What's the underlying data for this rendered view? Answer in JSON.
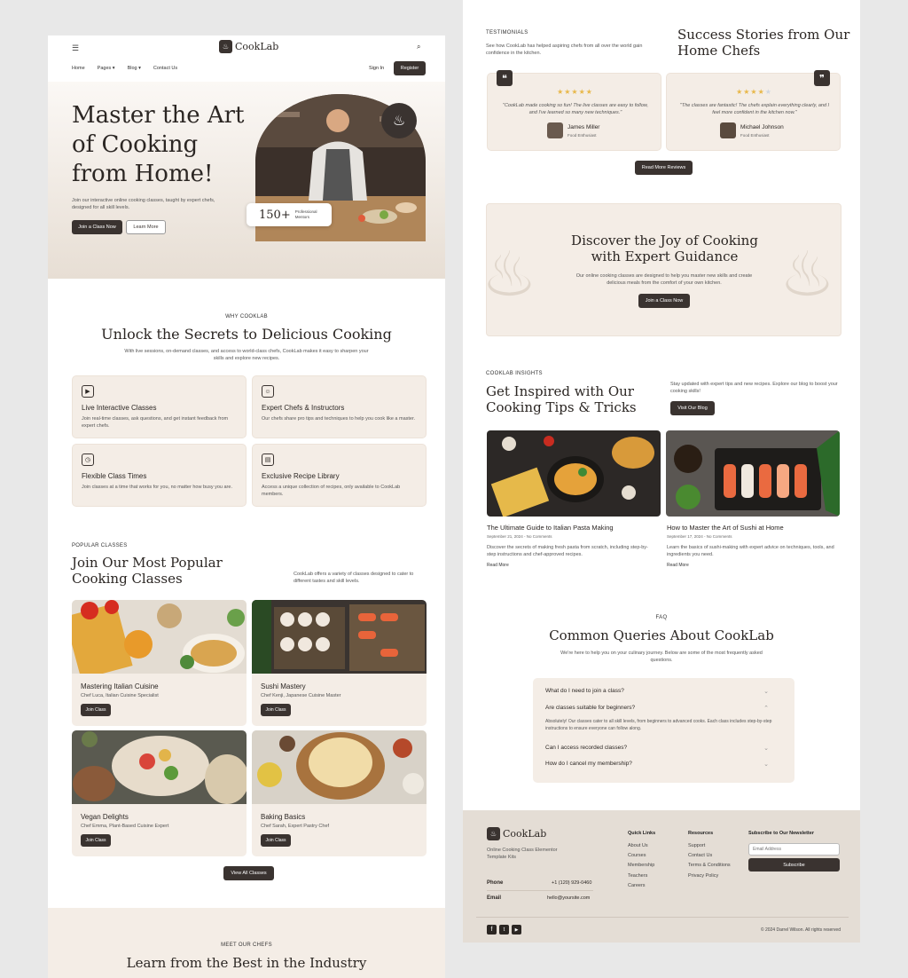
{
  "brand": {
    "name": "CookLab"
  },
  "nav": {
    "items": [
      {
        "label": "Home"
      },
      {
        "label": "Pages"
      },
      {
        "label": "Blog"
      },
      {
        "label": "Contact Us"
      }
    ],
    "signin": "Sign In",
    "register": "Register"
  },
  "hero": {
    "title_lines": [
      "Master the Art",
      "of Cooking",
      "from Home!"
    ],
    "desc": "Join our interactive online cooking classes, taught by expert chefs, designed for all skill levels.",
    "primary_btn": "Join a Class Now",
    "secondary_btn": "Learn More",
    "stat_number": "150+",
    "stat_label": "Professional Mentors"
  },
  "why": {
    "eyebrow": "WHY COOKLAB",
    "title": "Unlock the Secrets to Delicious Cooking",
    "desc": "With live sessions, on-demand classes, and access to world-class chefs, CookLab makes it easy to sharpen your skills and explore new recipes.",
    "features": [
      {
        "title": "Live Interactive Classes",
        "desc": "Join real-time classes, ask questions, and get instant feedback from expert chefs.",
        "icon": "video-icon"
      },
      {
        "title": "Expert Chefs & Instructors",
        "desc": "Our chefs share pro tips and techniques to help you cook like a master.",
        "icon": "chef-icon"
      },
      {
        "title": "Flexible Class Times",
        "desc": "Join classes at a time that works for you, no matter how busy you are.",
        "icon": "clock-icon"
      },
      {
        "title": "Exclusive Recipe Library",
        "desc": "Access a unique collection of recipes, only available to CookLab members.",
        "icon": "book-icon"
      }
    ]
  },
  "popular": {
    "eyebrow": "POPULAR CLASSES",
    "title_lines": [
      "Join Our Most Popular",
      "Cooking Classes"
    ],
    "desc": "CookLab offers a variety of classes designed to cater to different tastes and skill levels.",
    "classes": [
      {
        "title": "Mastering Italian Cuisine",
        "chef": "Chef Luca, Italian Cuisine Specialist",
        "button": "Join Class"
      },
      {
        "title": "Sushi Mastery",
        "chef": "Chef Kenji, Japanese Cuisine Master",
        "button": "Join Class"
      },
      {
        "title": "Vegan Delights",
        "chef": "Chef Emma, Plant-Based Cuisine Expert",
        "button": "Join Class"
      },
      {
        "title": "Baking Basics",
        "chef": "Chef Sarah, Expert Pastry Chef",
        "button": "Join Class"
      }
    ],
    "view_all": "View All Classes"
  },
  "chefs": {
    "eyebrow": "MEET OUR CHEFS",
    "title": "Learn from the Best in the Industry"
  },
  "testimonials": {
    "eyebrow": "TESTIMONIALS",
    "desc": "See how CookLab has helped aspiring chefs from all over the world gain confidence in the kitchen.",
    "title_lines": [
      "Success Stories from Our",
      "Home Chefs"
    ],
    "items": [
      {
        "quote": "\"CookLab made cooking so fun! The live classes are easy to follow, and I've learned so many new techniques.\"",
        "name": "James Miller",
        "role": "Food Enthusiast",
        "rating": 5
      },
      {
        "quote": "\"The classes are fantastic! The chefs explain everything clearly, and I feel more confident in the kitchen now.\"",
        "name": "Michael Johnson",
        "role": "Food Enthusiast",
        "rating": 4
      }
    ],
    "more_btn": "Read More Reviews"
  },
  "cta": {
    "title_lines": [
      "Discover the Joy of Cooking",
      "with Expert Guidance"
    ],
    "desc": "Our online cooking classes are designed to help you master new skills and create delicious meals from the comfort of your own kitchen.",
    "button": "Join a Class Now"
  },
  "insights": {
    "eyebrow": "COOKLAB INSIGHTS",
    "title_lines": [
      "Get Inspired with Our",
      "Cooking Tips & Tricks"
    ],
    "desc": "Stay updated with expert tips and new recipes. Explore our blog to boost your cooking skills!",
    "button": "Visit Our Blog",
    "posts": [
      {
        "title": "The Ultimate Guide to Italian Pasta Making",
        "meta": "September 21, 2024 - No Comments",
        "excerpt": "Discover the secrets of making fresh pasta from scratch, including step-by-step instructions and chef-approved recipes.",
        "link": "Read More"
      },
      {
        "title": "How to Master the Art of Sushi at Home",
        "meta": "September 17, 2024 - No Comments",
        "excerpt": "Learn the basics of sushi-making with expert advice on techniques, tools, and ingredients you need.",
        "link": "Read More"
      }
    ]
  },
  "faq": {
    "eyebrow": "FAQ",
    "title": "Common Queries About CookLab",
    "desc": "We're here to help you on your culinary journey. Below are some of the most frequently asked questions.",
    "items": [
      {
        "q": "What do I need to join a class?"
      },
      {
        "q": "Are classes suitable for beginners?",
        "a": "Absolutely! Our classes cater to all skill levels, from beginners to advanced cooks. Each class includes step-by-step instructions to ensure everyone can follow along."
      },
      {
        "q": "Can I access recorded classes?"
      },
      {
        "q": "How do I cancel my membership?"
      }
    ]
  },
  "footer": {
    "tagline": "Online Cooking Class Elementor Template Kits",
    "phone_label": "Phone",
    "phone": "+1 (120) 929-0460",
    "email_label": "Email",
    "email": "hello@yoursite.com",
    "quick_title": "Quick Links",
    "quick": [
      "About Us",
      "Courses",
      "Membership",
      "Teachers",
      "Careers"
    ],
    "res_title": "Resources",
    "res": [
      "Support",
      "Contact Us",
      "Terms & Conditions",
      "Privacy Policy"
    ],
    "news_title": "Subscribe to Our Newsletter",
    "email_placeholder": "Email Address",
    "subscribe": "Subscribe",
    "copyright": "© 2024 Darrel Wilson. All rights reserved"
  },
  "colors": {
    "accent": "#3a3330",
    "cream": "#f4ede6",
    "footer_bg": "#e4ddd5",
    "star": "#e8b84a"
  }
}
